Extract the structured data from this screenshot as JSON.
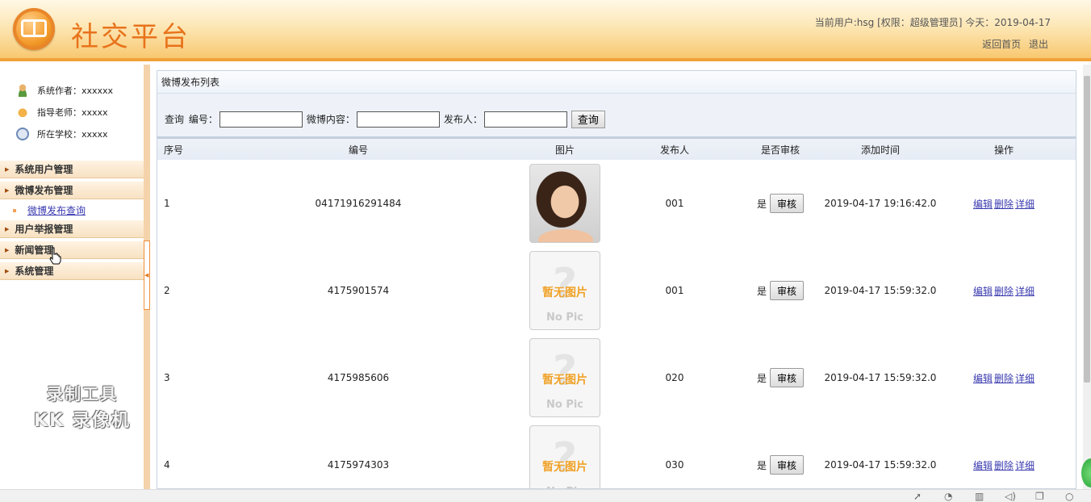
{
  "header": {
    "title": "社交平台",
    "user_info": "当前用户:hsg [权限：超级管理员] 今天：2019-04-17",
    "links": [
      "返回首页",
      "退出"
    ]
  },
  "sidebar": {
    "info": [
      {
        "label": "系统作者：xxxxxx",
        "icon": "author-icon"
      },
      {
        "label": "指导老师：xxxxx",
        "icon": "teacher-icon"
      },
      {
        "label": "所在学校：xxxxx",
        "icon": "school-icon"
      }
    ],
    "menu": [
      "系统用户管理",
      "微博发布管理",
      "用户举报管理",
      "新闻管理",
      "系统管理"
    ],
    "submenu": "微博发布查询"
  },
  "watermark": {
    "line1": "录制工具",
    "line2": "KK 录像机"
  },
  "main": {
    "panel_title": "微博发布列表",
    "search": {
      "label_query": "查询",
      "label_code": "编号：",
      "label_content": "微博内容：",
      "label_publisher": "发布人：",
      "button": "查询"
    },
    "columns": [
      "序号",
      "编号",
      "图片",
      "发布人",
      "是否审核",
      "添加时间",
      "操作"
    ],
    "nopic": {
      "cn": "暂无图片",
      "en": "No Pic",
      "q": "?"
    },
    "audit_button": "审核",
    "ops": [
      "编辑",
      "删除",
      "详细"
    ],
    "rows": [
      {
        "seq": "1",
        "code": "04171916291484",
        "publisher": "001",
        "audited": "是",
        "time": "2019-04-17 19:16:42.0"
      },
      {
        "seq": "2",
        "code": "4175901574",
        "publisher": "001",
        "audited": "是",
        "time": "2019-04-17 15:59:32.0"
      },
      {
        "seq": "3",
        "code": "4175985606",
        "publisher": "020",
        "audited": "是",
        "time": "2019-04-17 15:59:32.0"
      },
      {
        "seq": "4",
        "code": "4175974303",
        "publisher": "030",
        "audited": "是",
        "time": "2019-04-17 15:59:32.0"
      }
    ]
  },
  "taskbar": {
    "icons": [
      "rocket-icon",
      "browser-icon",
      "trash-icon",
      "volume-icon",
      "window-icon",
      "search-icon"
    ]
  },
  "colors": {
    "accent": "#e8731c",
    "link": "#3a3ab0",
    "header_border": "#f0a23a"
  }
}
